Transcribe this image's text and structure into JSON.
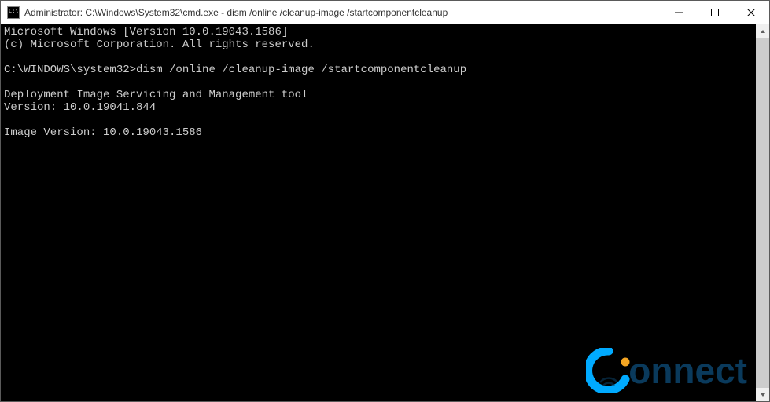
{
  "window": {
    "title": "Administrator: C:\\Windows\\System32\\cmd.exe - dism  /online /cleanup-image /startcomponentcleanup"
  },
  "terminal": {
    "lines": [
      "Microsoft Windows [Version 10.0.19043.1586]",
      "(c) Microsoft Corporation. All rights reserved.",
      "",
      "C:\\WINDOWS\\system32>dism /online /cleanup-image /startcomponentcleanup",
      "",
      "Deployment Image Servicing and Management tool",
      "Version: 10.0.19041.844",
      "",
      "Image Version: 10.0.19043.1586",
      ""
    ]
  },
  "watermark": {
    "text": "onnect"
  }
}
